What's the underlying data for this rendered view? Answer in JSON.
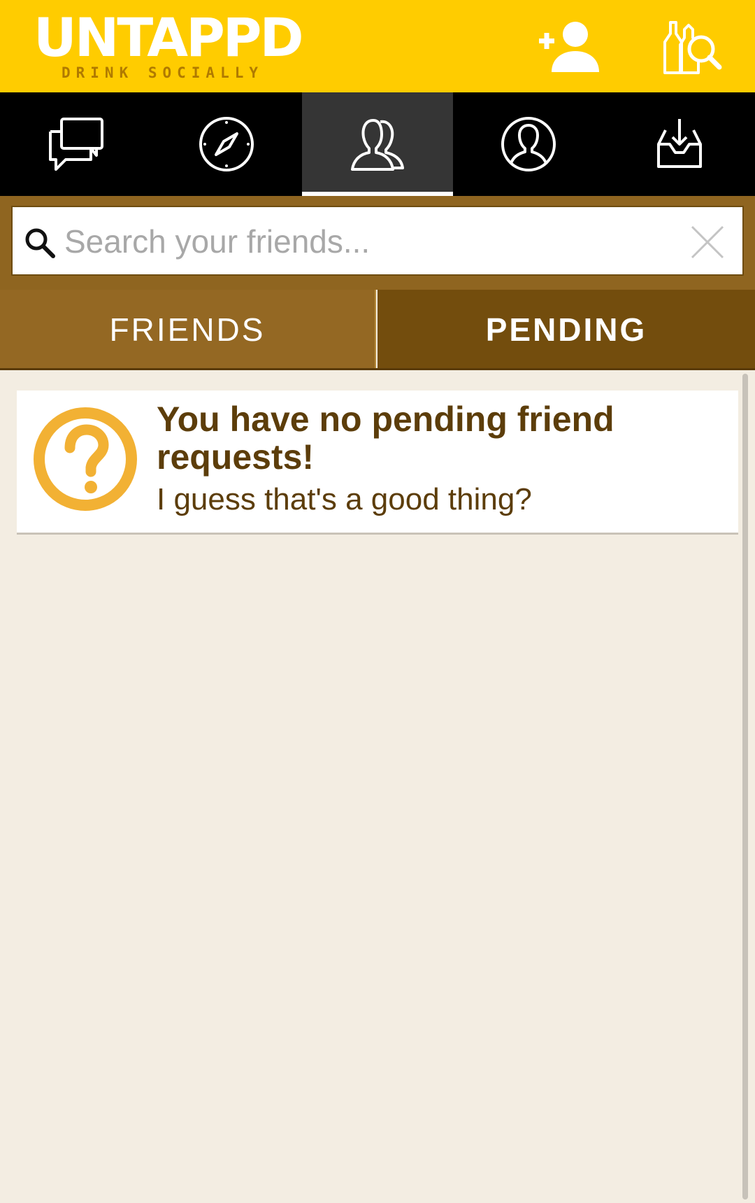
{
  "header": {
    "logo_text": "UNTAPPD",
    "logo_tagline": "DRINK SOCIALLY",
    "add_friend_icon": "add-person-icon",
    "beer_search_icon": "beer-search-icon"
  },
  "nav": {
    "tabs": [
      {
        "icon": "activity-chat-icon",
        "active": false
      },
      {
        "icon": "compass-icon",
        "active": false
      },
      {
        "icon": "friends-icon",
        "active": true
      },
      {
        "icon": "profile-icon",
        "active": false
      },
      {
        "icon": "inbox-download-icon",
        "active": false
      }
    ]
  },
  "search": {
    "placeholder": "Search your friends...",
    "value": ""
  },
  "segments": {
    "friends_label": "FRIENDS",
    "pending_label": "PENDING",
    "selected": "PENDING"
  },
  "empty_state": {
    "icon": "question-icon",
    "title": "You have no pending friend requests!",
    "subtitle": "I guess that's a good thing?"
  },
  "colors": {
    "header_bg": "#ffcc00",
    "nav_bg": "#000000",
    "search_bar_bg": "#8f6520",
    "segment_inactive": "#946823",
    "segment_active": "#734d0d",
    "text_brown": "#5c3d0a",
    "icon_orange": "#f2b134",
    "page_bg": "#f3ede2"
  }
}
